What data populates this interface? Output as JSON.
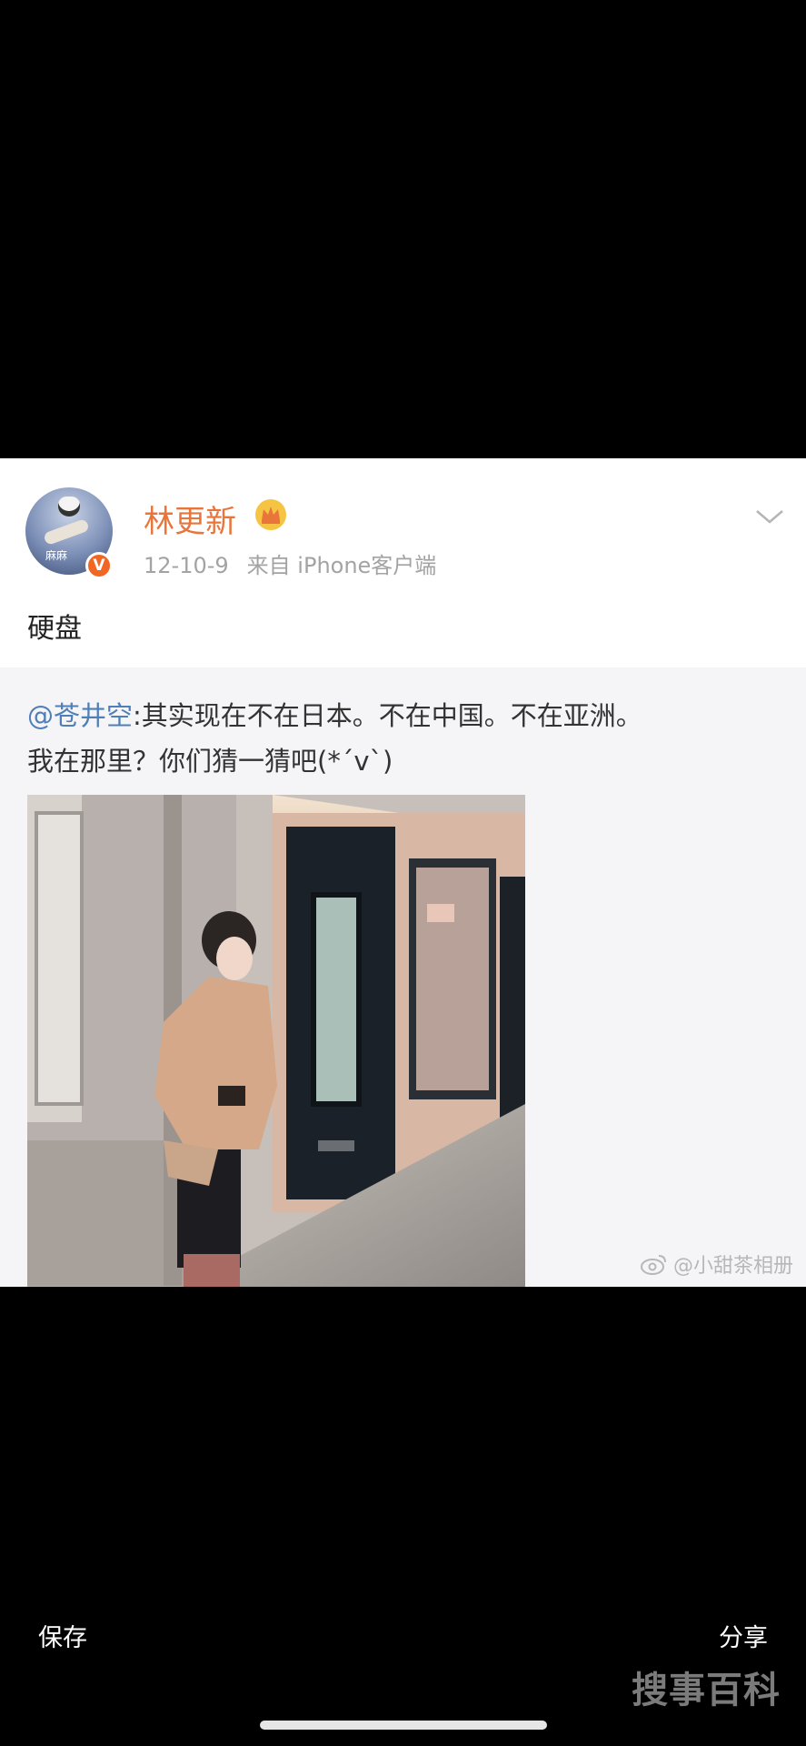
{
  "post": {
    "username": "林更新",
    "date": "12-10-9",
    "source": "来自 iPhone客户端",
    "text": "硬盘",
    "avatar_label": "麻麻",
    "verified_badge": "V",
    "icons": {
      "crown": "crown-icon",
      "chevron": "chevron-down-icon"
    }
  },
  "repost": {
    "mention": "@苍井空",
    "text_line1": ":其实现在不在日本。不在中国。不在亚洲。",
    "text_line2": "我在那里？你们猜一猜吧(*´v`)"
  },
  "photo_watermark": "@小甜茶相册",
  "bottom_bar": {
    "save_label": "保存",
    "share_label": "分享"
  },
  "brand_watermark": "搜事百科",
  "colors": {
    "username": "#e8753a",
    "mention": "#4f7fb8",
    "verified": "#f16623",
    "background": "#000000"
  }
}
